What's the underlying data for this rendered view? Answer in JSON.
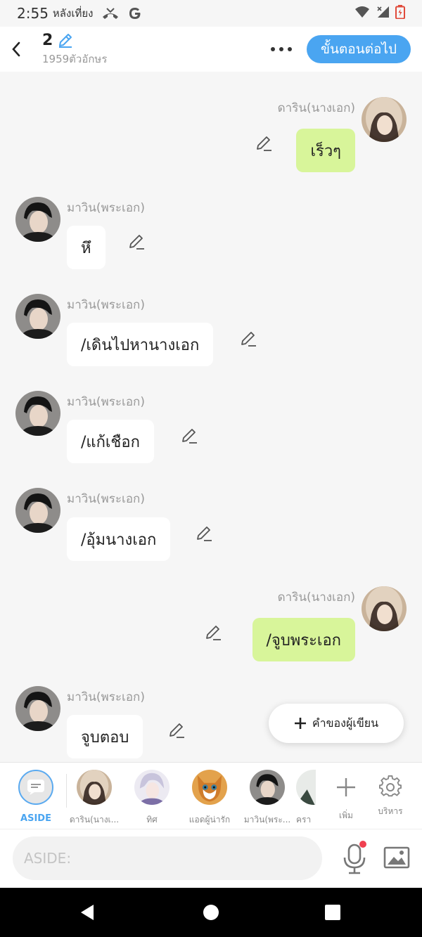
{
  "status_bar": {
    "time": "2:55",
    "period": "หลังเที่ยง"
  },
  "header": {
    "title": "2",
    "char_count": "1959ตัวอักษร",
    "next_button": "ขั้นตอนต่อไป"
  },
  "messages": [
    {
      "speaker": "ดาริน(นางเอก)",
      "text": "เร็วๆ",
      "side": "right"
    },
    {
      "speaker": "มาวิน(พระเอก)",
      "text": "หึ",
      "side": "left"
    },
    {
      "speaker": "มาวิน(พระเอก)",
      "text": "/เดินไปหานางเอก",
      "side": "left"
    },
    {
      "speaker": "มาวิน(พระเอก)",
      "text": "/แก้เชือก",
      "side": "left"
    },
    {
      "speaker": "มาวิน(พระเอก)",
      "text": "/อุ้มนางเอก",
      "side": "left"
    },
    {
      "speaker": "ดาริน(นางเอก)",
      "text": "/จูบพระเอก",
      "side": "right"
    },
    {
      "speaker": "มาวิน(พระเอก)",
      "text": "จูบตอบ",
      "side": "left"
    }
  ],
  "fab": {
    "label": "คำของผู้เขียน"
  },
  "characters": [
    {
      "label": "ASIDE"
    },
    {
      "label": "ดาริน(นางเ..."
    },
    {
      "label": "ทิศ"
    },
    {
      "label": "แอดผู้น่ารัก"
    },
    {
      "label": "มาวิน(พระ..."
    },
    {
      "label": "ครา"
    }
  ],
  "actions": {
    "add_label": "เพิ่ม",
    "manage_label": "บริหาร"
  },
  "input": {
    "placeholder": "ASIDE:"
  },
  "colors": {
    "accent": "#4aa5f1",
    "right_bubble": "#d8f59a",
    "left_bubble": "#ffffff",
    "background": "#f6f6f6",
    "mic_dot": "#f04050"
  }
}
